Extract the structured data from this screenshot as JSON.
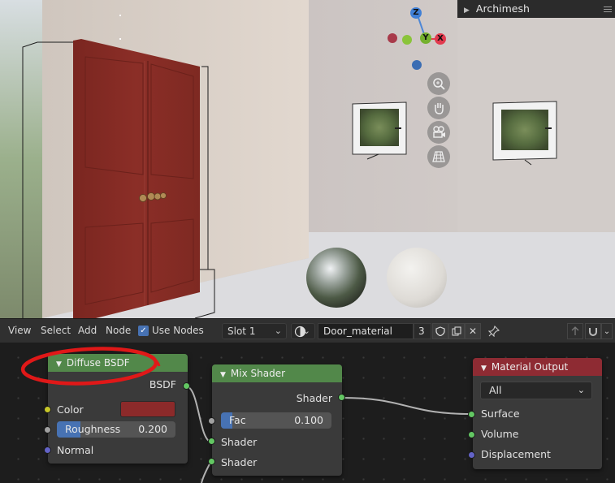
{
  "viewport": {
    "panel_title": "Archimesh",
    "gizmo": {
      "z_label": "Z",
      "y_label": "Y",
      "x_label": "X"
    },
    "nav_icons": [
      "zoom-icon",
      "pan-hand-icon",
      "camera-icon",
      "ortho-grid-icon"
    ]
  },
  "header": {
    "menus": [
      "View",
      "Select",
      "Add",
      "Node"
    ],
    "use_nodes_label": "Use Nodes",
    "use_nodes_checked": true,
    "slot": "Slot 1",
    "material_name": "Door_material",
    "user_count": "3"
  },
  "nodes": {
    "diffuse": {
      "title": "Diffuse BSDF",
      "output": "BSDF",
      "color_label": "Color",
      "color_value": "#8c2a2a",
      "roughness_label": "Roughness",
      "roughness_value": "0.200",
      "roughness_fraction": 0.2,
      "normal_label": "Normal"
    },
    "mix": {
      "title": "Mix Shader",
      "output": "Shader",
      "fac_label": "Fac",
      "fac_value": "0.100",
      "fac_fraction": 0.1,
      "input1": "Shader",
      "input2": "Shader"
    },
    "output": {
      "title": "Material Output",
      "target": "All",
      "surface": "Surface",
      "volume": "Volume",
      "displacement": "Displacement"
    }
  },
  "colors": {
    "node_green": "#52884a",
    "node_red": "#8e2b33",
    "accent_blue": "#4772b3",
    "annotation_red": "#e01818"
  }
}
